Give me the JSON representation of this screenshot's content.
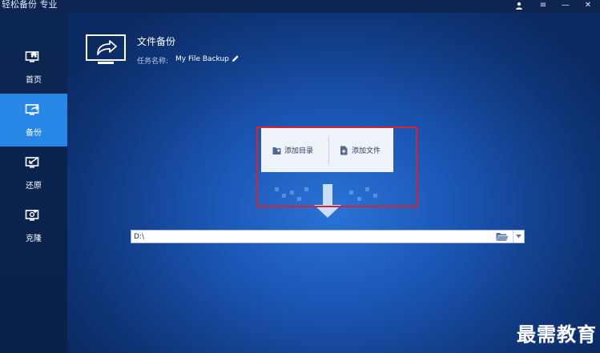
{
  "app": {
    "title": "轻松备份 专业"
  },
  "window_controls": {
    "icons": [
      "user-icon",
      "menu-icon",
      "minimize-icon",
      "close-icon"
    ],
    "menu_glyph": "≡",
    "minimize_glyph": "—",
    "close_glyph": "✕"
  },
  "sidebar": {
    "items": [
      {
        "label": "首页",
        "icon": "home-monitor-icon",
        "active": false
      },
      {
        "label": "备份",
        "icon": "backup-monitor-icon",
        "active": true
      },
      {
        "label": "还原",
        "icon": "restore-monitor-icon",
        "active": false
      },
      {
        "label": "克隆",
        "icon": "clone-monitor-icon",
        "active": false
      }
    ]
  },
  "header": {
    "title": "文件备份",
    "task_label": "任务名称:",
    "task_name": "My File Backup",
    "icon": "backup-share-icon"
  },
  "add_panel": {
    "add_folder_label": "添加目录",
    "add_file_label": "添加文件",
    "folder_icon": "add-folder-icon",
    "file_icon": "add-file-icon"
  },
  "destination": {
    "path_value": "D:\\",
    "browse_icon": "folder-open-icon",
    "dropdown_icon": "chevron-down-icon"
  },
  "watermark": {
    "text": "最需教育"
  },
  "colors": {
    "accent": "#2787e6",
    "sidebar_bg": "#0c2653",
    "highlight_border": "#d8232a",
    "panel_bg": "#eef3fa"
  }
}
